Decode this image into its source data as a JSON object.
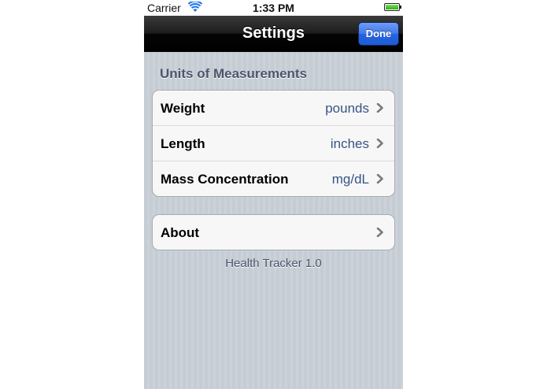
{
  "status_bar": {
    "carrier": "Carrier",
    "time": "1:33 PM",
    "wifi_icon": "wifi-icon",
    "battery_icon": "battery-icon"
  },
  "nav_bar": {
    "title": "Settings",
    "done_label": "Done"
  },
  "units_section": {
    "header": "Units of Measurements",
    "rows": [
      {
        "label": "Weight",
        "value": "pounds"
      },
      {
        "label": "Length",
        "value": "inches"
      },
      {
        "label": "Mass Concentration",
        "value": "mg/dL"
      }
    ]
  },
  "about_section": {
    "rows": [
      {
        "label": "About"
      }
    ]
  },
  "footer": {
    "version_text": "Health Tracker 1.0"
  },
  "colors": {
    "accent_blue": "#2563e0",
    "value_text": "#385487",
    "header_text": "#4c566c",
    "background": "#c5ccd4"
  }
}
